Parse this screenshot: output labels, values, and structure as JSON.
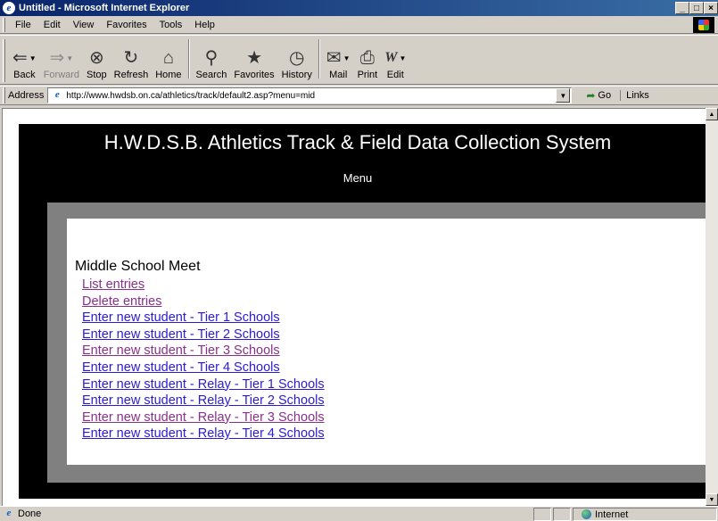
{
  "window": {
    "title": "Untitled - Microsoft Internet Explorer",
    "minimize": "_",
    "restore": "□",
    "close": "×"
  },
  "menu": [
    {
      "name": "file",
      "label": "File"
    },
    {
      "name": "edit",
      "label": "Edit"
    },
    {
      "name": "view",
      "label": "View"
    },
    {
      "name": "favorites",
      "label": "Favorites"
    },
    {
      "name": "tools",
      "label": "Tools"
    },
    {
      "name": "help",
      "label": "Help"
    }
  ],
  "toolbar": {
    "back": "Back",
    "forward": "Forward",
    "stop": "Stop",
    "refresh": "Refresh",
    "home": "Home",
    "search": "Search",
    "favorites": "Favorites",
    "history": "History",
    "mail": "Mail",
    "print": "Print",
    "edit": "Edit"
  },
  "address": {
    "label": "Address",
    "url": "http://www.hwdsb.on.ca/athletics/track/default2.asp?menu=mid",
    "go": "Go",
    "links": "Links"
  },
  "page": {
    "title": "H.W.D.S.B. Athletics Track & Field Data Collection System",
    "subtitle": "Menu",
    "section_heading": "Middle School Meet",
    "links": [
      {
        "label": "List entries",
        "visited": true
      },
      {
        "label": "Delete entries",
        "visited": true
      },
      {
        "label": "Enter new student - Tier 1 Schools",
        "visited": false
      },
      {
        "label": "Enter new student - Tier 2 Schools",
        "visited": false
      },
      {
        "label": "Enter new student - Tier 3 Schools",
        "visited": true
      },
      {
        "label": "Enter new student - Tier 4 Schools",
        "visited": false
      },
      {
        "label": "Enter new student - Relay - Tier 1 Schools",
        "visited": false
      },
      {
        "label": "Enter new student - Relay - Tier 2 Schools",
        "visited": false
      },
      {
        "label": "Enter new student - Relay - Tier 3 Schools",
        "visited": true
      },
      {
        "label": "Enter new student - Relay - Tier 4 Schools",
        "visited": false
      }
    ]
  },
  "status": {
    "text": "Done",
    "zone": "Internet"
  },
  "colors": {
    "link": "#2a1ad8",
    "visited_link": "#8a2f8a",
    "page_background": "#000000",
    "panel_gray": "#808080"
  }
}
